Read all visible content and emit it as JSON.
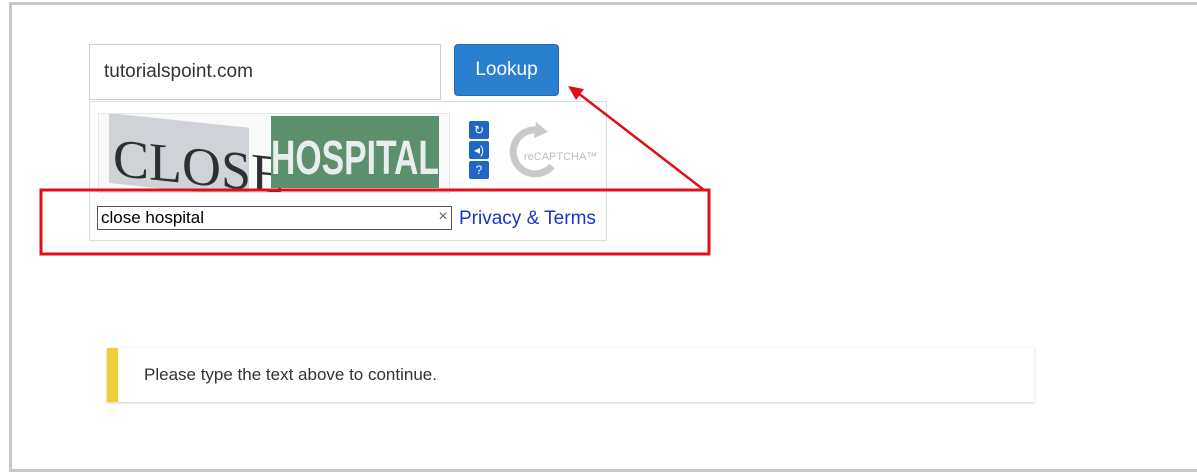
{
  "form": {
    "domain_value": "tutorialspoint.com",
    "lookup_label": "Lookup"
  },
  "captcha": {
    "image_word_1": "CLOSE",
    "image_word_2": "HOSPITAL",
    "answer_value": "close hospital",
    "clear_symbol": "×",
    "privacy_label": "Privacy & Terms",
    "logo_text": "reCAPTCHA™",
    "tools": [
      "refresh-icon",
      "audio-icon",
      "help-icon"
    ]
  },
  "alert": {
    "message": "Please type the text above to continue.",
    "accent_color": "#efcd3a"
  },
  "colors": {
    "primary": "#2a7fcf",
    "annotation_red": "#e0101a",
    "link": "#1a33c9"
  }
}
